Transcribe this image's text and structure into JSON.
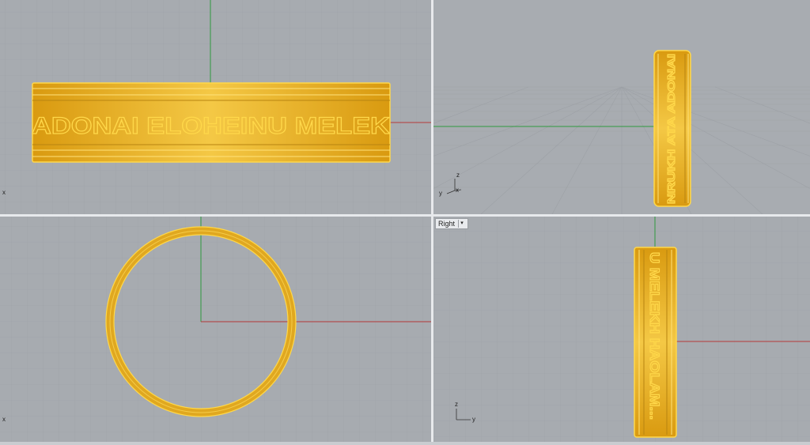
{
  "viewports": {
    "top": {
      "axis_label": "x"
    },
    "perspective": {
      "axis_z": "z",
      "axis_y": "y",
      "axis_x": "x"
    },
    "front": {
      "axis_label": "x"
    },
    "right": {
      "label": "Right",
      "axis_z": "z",
      "axis_y": "y"
    }
  },
  "ring": {
    "engraving_top": "ADONAI ELOHEINU MELEK",
    "engraving_perspective": "NRUKH ATA ADONAI",
    "engraving_right": "U MELEKH HAOLAM..."
  },
  "colors": {
    "viewport_bg": "#a7abb0",
    "grid_line": "#9da1a6",
    "grid_major": "#8f9398",
    "x_axis": "#b53a3a",
    "y_axis": "#2f9a3e",
    "ring_fill": "#e0a820",
    "ring_highlight": "#ffd84a"
  }
}
